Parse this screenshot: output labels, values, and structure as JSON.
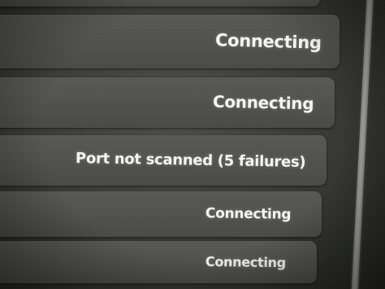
{
  "status_list": {
    "rows": [
      {
        "status": ""
      },
      {
        "status": "Connecting"
      },
      {
        "status": "Connecting"
      },
      {
        "status": "Port not scanned (5 failures)"
      },
      {
        "status": "Connecting"
      },
      {
        "status": "Connecting"
      }
    ]
  },
  "colors": {
    "background": "#3b3c38",
    "row": "#535450",
    "text": "#f4f4f2",
    "scrollbar_thumb": "#a6a7a3"
  }
}
